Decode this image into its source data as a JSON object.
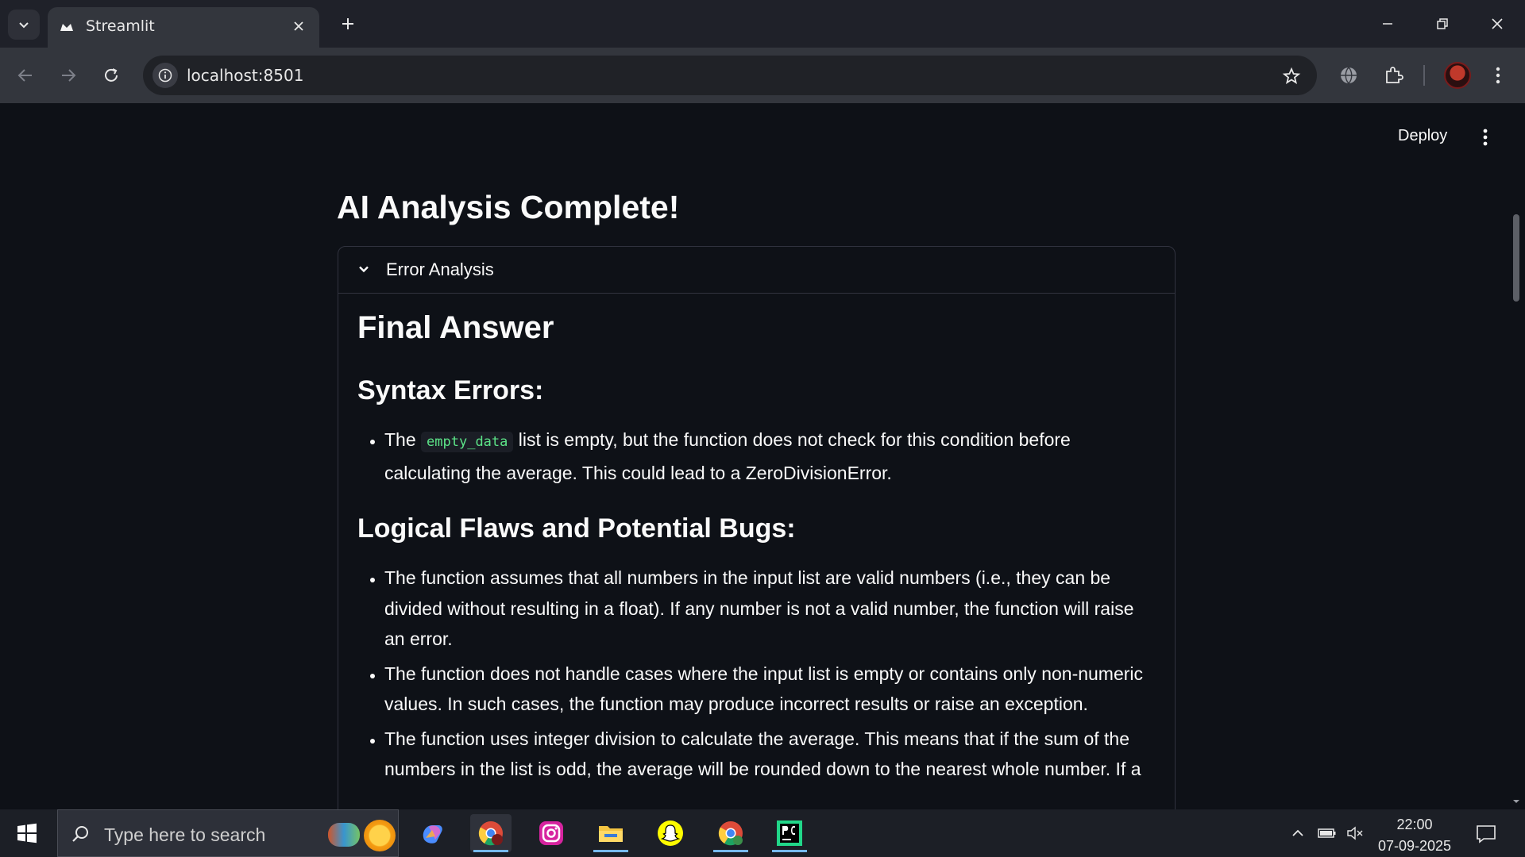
{
  "browser": {
    "tab_title": "Streamlit",
    "url": "localhost:8501"
  },
  "app": {
    "deploy_label": "Deploy",
    "title": "AI Analysis Complete!",
    "expander": {
      "label": "Error Analysis",
      "final_heading": "Final Answer",
      "syntax_heading": "Syntax Errors:",
      "syntax_items": [
        {
          "pre": "The",
          "code": "empty_data",
          "post": "list is empty, but the function does not check for this condition before calculating the average. This could lead to a ZeroDivisionError."
        }
      ],
      "logic_heading": "Logical Flaws and Potential Bugs:",
      "logic_items": [
        "The function assumes that all numbers in the input list are valid numbers (i.e., they can be divided without resulting in a float). If any number is not a valid number, the function will raise an error.",
        "The function does not handle cases where the input list is empty or contains only non-numeric values. In such cases, the function may produce incorrect results or raise an exception.",
        "The function uses integer division to calculate the average. This means that if the sum of the numbers in the list is odd, the average will be rounded down to the nearest whole number. If a"
      ]
    }
  },
  "taskbar": {
    "search_placeholder": "Type here to search",
    "time": "22:00",
    "date": "07-09-2025"
  },
  "colors": {
    "page_bg": "#0e1117",
    "code_text": "#5ce488",
    "border": "#31333f"
  }
}
